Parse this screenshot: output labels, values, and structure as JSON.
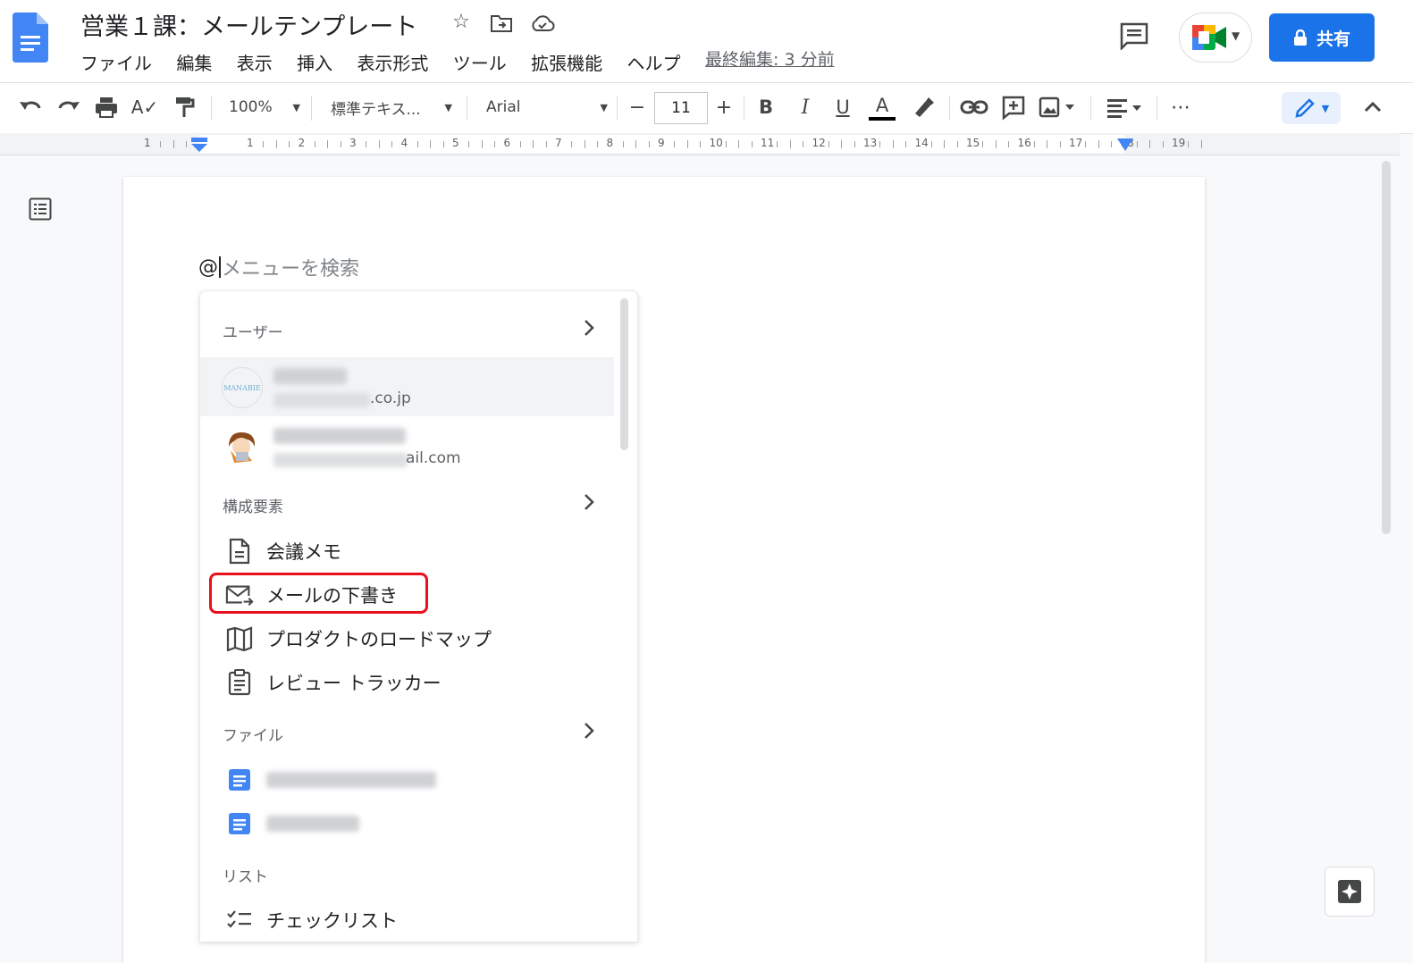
{
  "app": {
    "doc_title": "営業１課：メールテンプレート",
    "last_edit": "最終編集: 3 分前",
    "share_label": "共有"
  },
  "menu": {
    "items": [
      "ファイル",
      "編集",
      "表示",
      "挿入",
      "表示形式",
      "ツール",
      "拡張機能",
      "ヘルプ"
    ]
  },
  "toolbar": {
    "zoom": "100%",
    "style": "標準テキス...",
    "font": "Arial",
    "font_size": "11",
    "minus": "−",
    "plus": "+",
    "bold": "B",
    "italic": "I",
    "underline": "U",
    "text_color": "A",
    "more": "⋯"
  },
  "ruler": {
    "labels": [
      "1",
      "1",
      "2",
      "3",
      "4",
      "5",
      "6",
      "7",
      "8",
      "9",
      "10",
      "11",
      "12",
      "13",
      "14",
      "15",
      "16",
      "17",
      "18",
      "19"
    ]
  },
  "search": {
    "at": "@",
    "placeholder": "メニューを検索"
  },
  "mention_menu": {
    "users_heading": "ユーザー",
    "users": [
      {
        "avatar_text": "MANABIE",
        "email_tail": ".co.jp"
      },
      {
        "avatar_text": "",
        "email_tail": "ail.com"
      }
    ],
    "components_heading": "構成要素",
    "components": [
      "会議メモ",
      "メールの下書き",
      "プロダクトのロードマップ",
      "レビュー トラッカー"
    ],
    "files_heading": "ファイル",
    "lists_heading": "リスト",
    "lists": [
      "チェックリスト"
    ]
  },
  "colors": {
    "accent": "#1a73e8",
    "highlight": "#e8101c",
    "doc_blue": "#4285f4"
  },
  "icons": [
    "docs-logo-icon",
    "star-icon",
    "move-to-folder-icon",
    "cloud-status-icon",
    "comments-icon",
    "meet-icon",
    "lock-icon",
    "undo-icon",
    "redo-icon",
    "print-icon",
    "spellcheck-icon",
    "paint-format-icon",
    "highlight-pen-icon",
    "link-icon",
    "add-comment-icon",
    "image-icon",
    "align-icon",
    "pencil-icon",
    "collapse-icon",
    "outline-icon",
    "chevron-right-icon",
    "document-icon",
    "mail-icon",
    "map-icon",
    "clipboard-icon",
    "checklist-icon",
    "explore-icon"
  ]
}
